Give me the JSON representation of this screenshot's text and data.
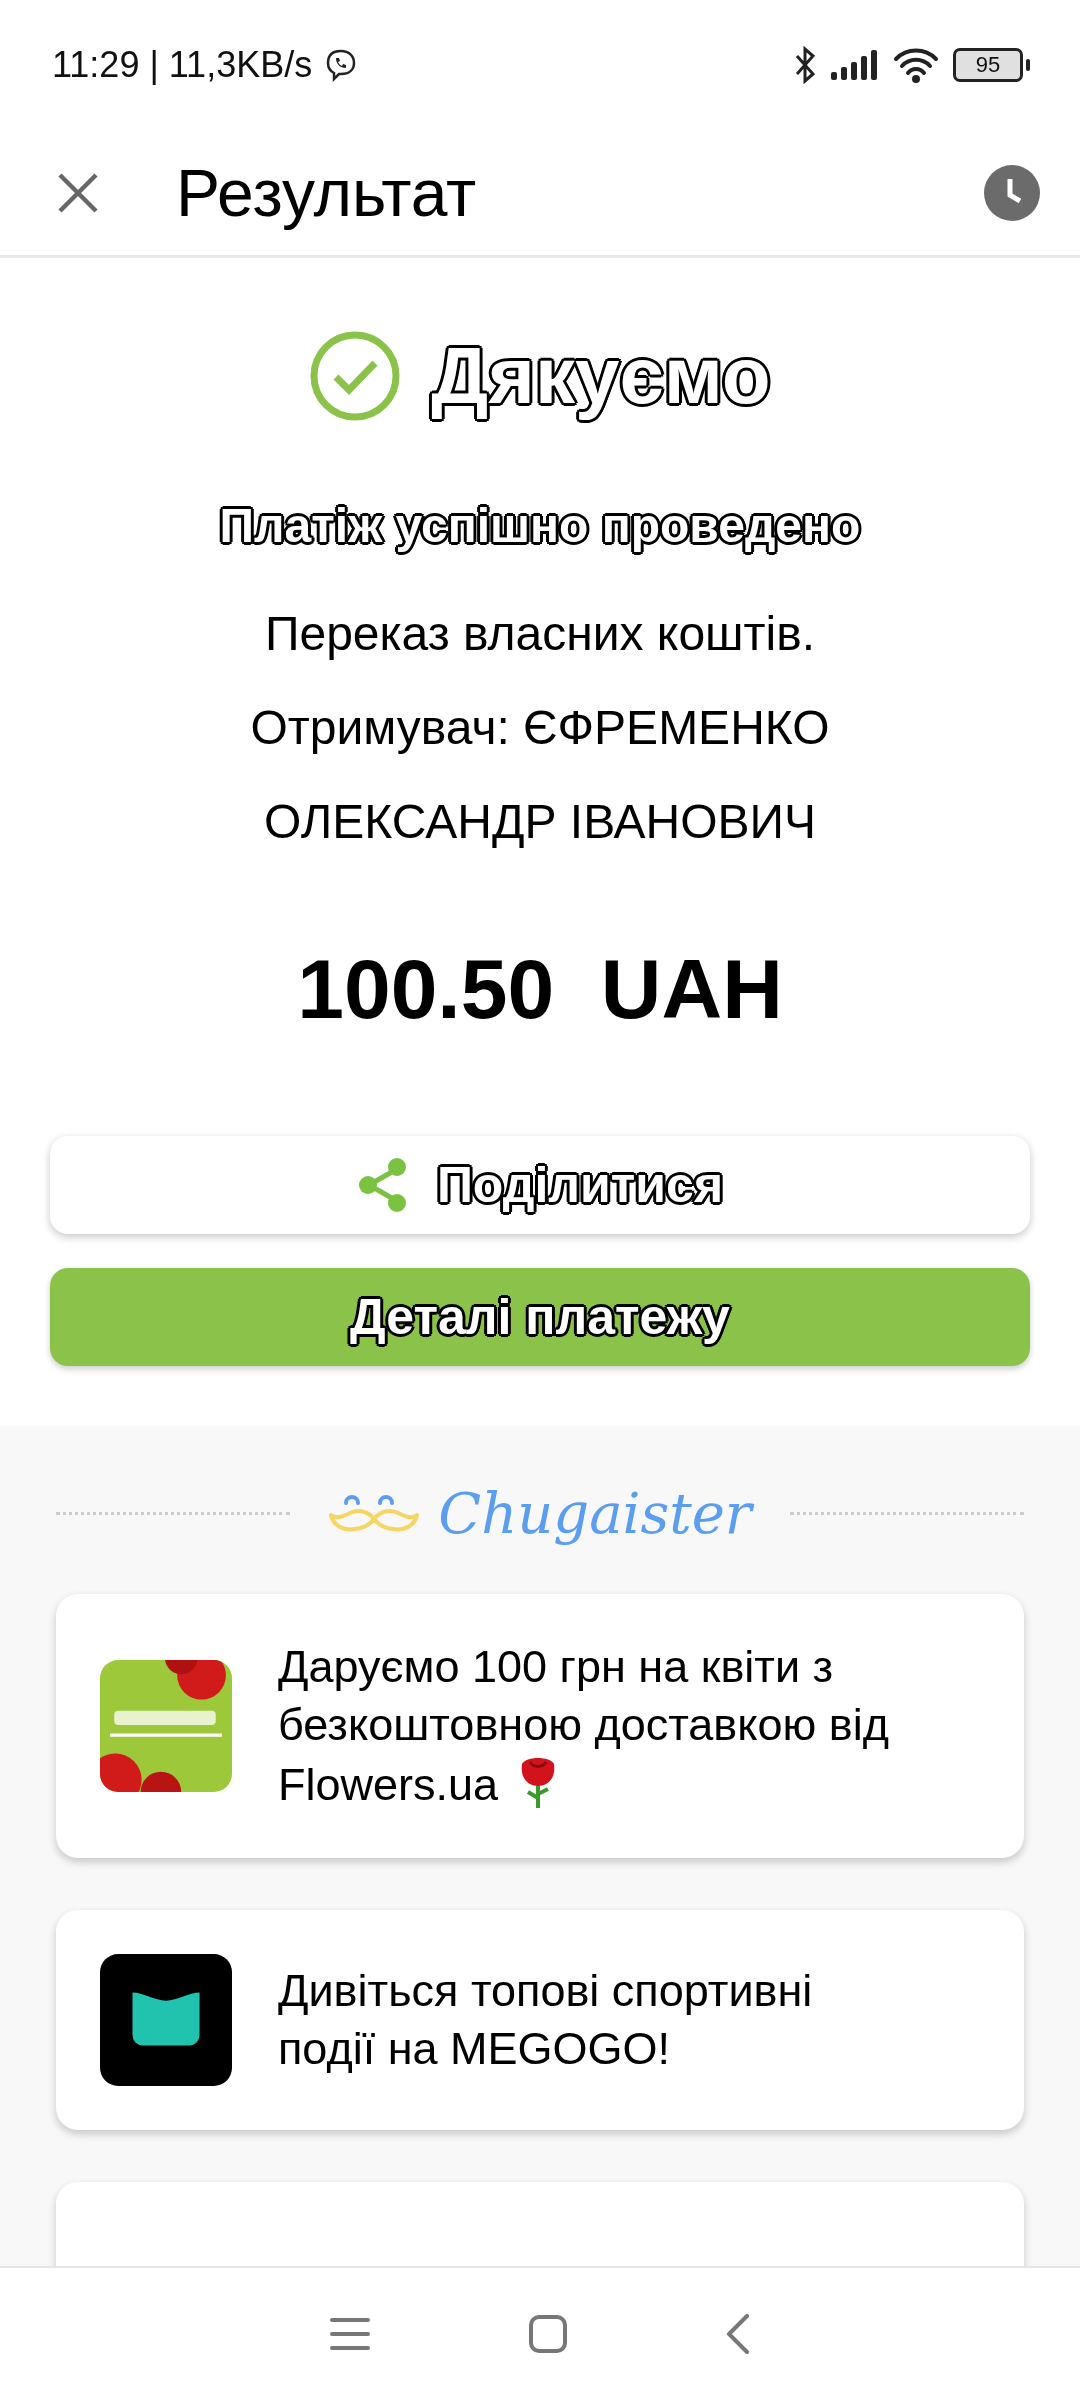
{
  "status_bar": {
    "time_speed": "11:29 | 11,3KB/s",
    "battery": "95"
  },
  "header": {
    "title": "Результат"
  },
  "result": {
    "heading": "Дякуємо",
    "subtitle": "Платіж успішно проведено",
    "description_lines": [
      "Переказ власних коштів.",
      "Отримувач: ЄФРЕМЕНКО",
      "ОЛЕКСАНДР ІВАНОВИЧ"
    ],
    "amount": "100.50  UAH"
  },
  "actions": [
    {
      "kind": "share",
      "label": "Поділитися"
    },
    {
      "kind": "primary",
      "label": "Деталі платежу"
    }
  ],
  "promo": {
    "brand": "Chugaister",
    "offers": [
      {
        "kind": "flowers",
        "text": "Даруємо 100 грн на квіти з безкоштовною доставкою від Flowers.ua"
      },
      {
        "kind": "megogo",
        "text": "Дивіться топові спортивні події на MEGOGO!"
      }
    ]
  }
}
